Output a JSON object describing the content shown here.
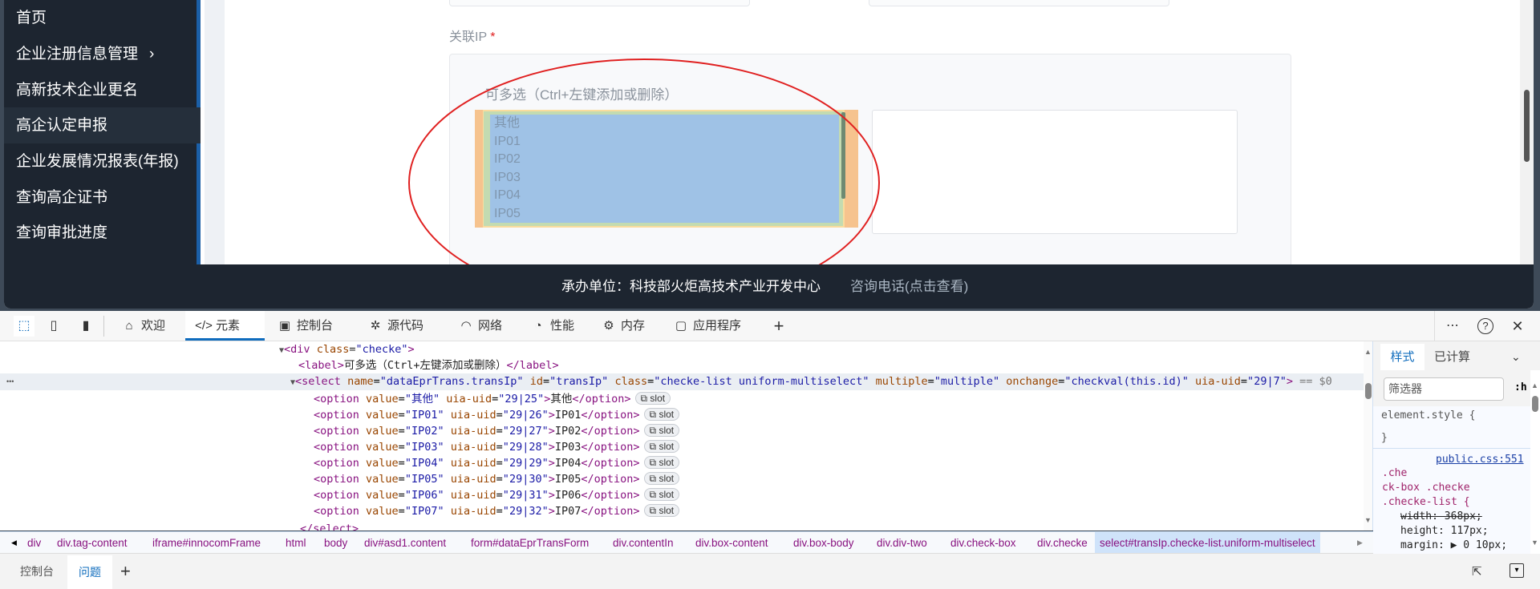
{
  "sidebar": {
    "items": [
      {
        "label": "首页"
      },
      {
        "label": "企业注册信息管理",
        "chevron": "›"
      },
      {
        "label": "高新技术企业更名"
      },
      {
        "label": "高企认定申报",
        "active": true
      },
      {
        "label": "企业发展情况报表(年报)"
      },
      {
        "label": "查询高企证书"
      },
      {
        "label": "查询审批进度"
      }
    ]
  },
  "form": {
    "ip_label": "关联IP",
    "required_mark": "*",
    "multi_label": "可多选（Ctrl+左键添加或删除）",
    "options": [
      "其他",
      "IP01",
      "IP02",
      "IP03",
      "IP04",
      "IP05"
    ],
    "annotation_color": "#e02020"
  },
  "footer": {
    "organizer": "承办单位：科技部火炬高技术产业开发中心",
    "contact": "咨询电话(点击查看)"
  },
  "devtools": {
    "tabs": [
      {
        "label": "欢迎",
        "icon": "home-icon"
      },
      {
        "label": "元素",
        "icon": "code-icon",
        "active": true
      },
      {
        "label": "控制台",
        "icon": "console-icon"
      },
      {
        "label": "源代码",
        "icon": "bug-icon"
      },
      {
        "label": "网络",
        "icon": "wifi-icon"
      },
      {
        "label": "性能",
        "icon": "gauge-icon"
      },
      {
        "label": "内存",
        "icon": "chip-icon"
      },
      {
        "label": "应用程序",
        "icon": "app-icon"
      }
    ],
    "dom": {
      "div_line": {
        "tag": "div",
        "attr": "class",
        "val": "checke"
      },
      "label_line": {
        "text": "可多选（Ctrl+左键添加或删除）"
      },
      "select_line": {
        "name": "dataEprTrans.transIp",
        "id": "transIp",
        "class": "checke-list uniform-multiselect",
        "multiple": "multiple",
        "onchange": "checkval(this.id)",
        "uid": "29|7",
        "marker": "== $0"
      },
      "options": [
        {
          "value": "其他",
          "uid": "29|25"
        },
        {
          "value": "IP01",
          "uid": "29|26"
        },
        {
          "value": "IP02",
          "uid": "29|27"
        },
        {
          "value": "IP03",
          "uid": "29|28"
        },
        {
          "value": "IP04",
          "uid": "29|29"
        },
        {
          "value": "IP05",
          "uid": "29|30"
        },
        {
          "value": "IP06",
          "uid": "29|31"
        },
        {
          "value": "IP07",
          "uid": "29|32"
        }
      ],
      "slot_label": "slot",
      "close_select": "</select>",
      "ellipsis": "•••"
    },
    "styles": {
      "tab_styles": "样式",
      "tab_computed": "已计算",
      "filter_placeholder": "筛选器",
      "hov": ":h",
      "element_style": "element.style {",
      "close_brace": "}",
      "source": "public.css:551",
      "selector_1": ".che",
      "selector_2": "ck-box .checke",
      "selector_3": ".checke-list {",
      "width_rule": "width: 368px;",
      "height_rule": "height: 117px;",
      "margin_rule": "margin: ▶ 0 10px;"
    },
    "breadcrumbs": [
      "div",
      "div.tag-content",
      "iframe#innocomFrame",
      "html",
      "body",
      "div#asd1.content",
      "form#dataEprTransForm",
      "div.contentIn",
      "div.box-content",
      "div.box-body",
      "div.div-two",
      "div.check-box",
      "div.checke",
      "select#transIp.checke-list.uniform-multiselect"
    ],
    "drawer": {
      "console": "控制台",
      "issues": "问题",
      "add": "+"
    }
  }
}
